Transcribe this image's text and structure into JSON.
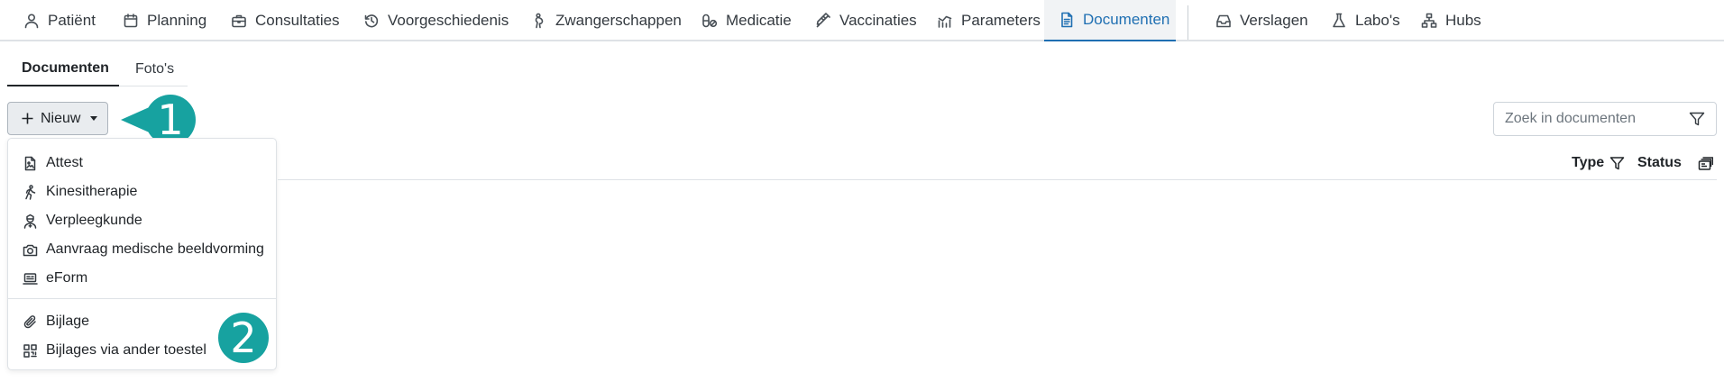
{
  "nav": {
    "tabs": [
      {
        "label": "Patiënt",
        "icon": "person-icon"
      },
      {
        "label": "Planning",
        "icon": "calendar-icon"
      },
      {
        "label": "Consultaties",
        "icon": "briefcase-icon"
      },
      {
        "label": "Voorgeschiedenis",
        "icon": "history-icon"
      },
      {
        "label": "Zwangerschappen",
        "icon": "pregnancy-icon"
      },
      {
        "label": "Medicatie",
        "icon": "pills-icon"
      },
      {
        "label": "Vaccinaties",
        "icon": "syringe-icon"
      },
      {
        "label": "Parameters",
        "icon": "chart-icon"
      },
      {
        "label": "Documenten",
        "icon": "document-icon",
        "active": true
      },
      {
        "label": "Verslagen",
        "icon": "inbox-icon"
      },
      {
        "label": "Labo's",
        "icon": "flask-icon"
      },
      {
        "label": "Hubs",
        "icon": "hierarchy-icon"
      }
    ]
  },
  "subtabs": [
    {
      "label": "Documenten",
      "active": true
    },
    {
      "label": "Foto's"
    }
  ],
  "toolbar": {
    "new_label": "Nieuw"
  },
  "dropdown": {
    "items": [
      {
        "label": "Attest",
        "icon": "file-image-icon"
      },
      {
        "label": "Kinesitherapie",
        "icon": "walking-person-icon"
      },
      {
        "label": "Verpleegkunde",
        "icon": "nurse-icon"
      },
      {
        "label": "Aanvraag medische beeldvorming",
        "icon": "camera-icon"
      },
      {
        "label": "eForm",
        "icon": "laptop-form-icon"
      },
      {
        "label": "Bijlage",
        "icon": "paperclip-icon"
      },
      {
        "label": "Bijlages via ander toestel",
        "icon": "qr-code-icon"
      }
    ]
  },
  "search": {
    "placeholder": "Zoek in documenten"
  },
  "table": {
    "columns": [
      {
        "label": "Type",
        "icon": "filter-icon"
      },
      {
        "label": "Status"
      }
    ]
  },
  "callouts": [
    {
      "number": "1"
    },
    {
      "number": "2"
    }
  ],
  "colors": {
    "accent": "#1f6fb2",
    "callout": "#17a2a0"
  }
}
